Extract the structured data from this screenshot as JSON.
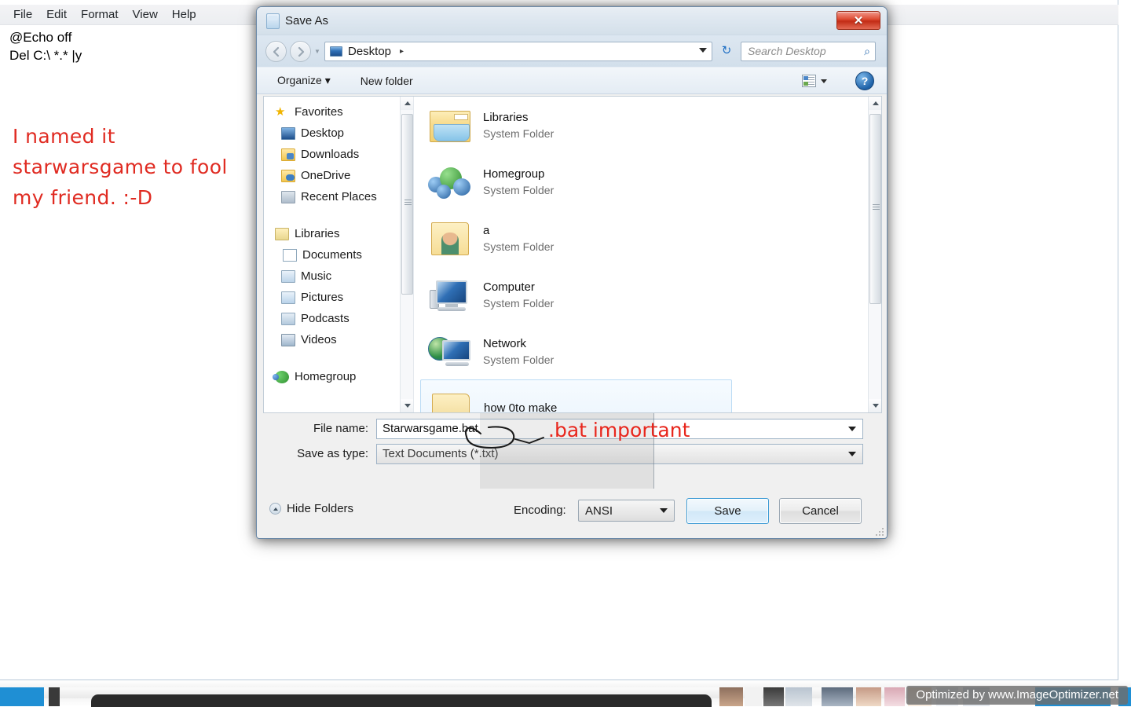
{
  "notepad": {
    "menu": [
      "File",
      "Edit",
      "Format",
      "View",
      "Help"
    ],
    "content": "@Echo off\nDel C:\\ *.* |y",
    "annotation": "I named it\nstarwarsgame to fool\nmy friend. :-D"
  },
  "dialog": {
    "title": "Save As",
    "close_label": "✕",
    "address": {
      "crumb": "Desktop",
      "crumb_arrow": "▸",
      "refresh_glyph": "↻"
    },
    "search": {
      "placeholder": "Search Desktop",
      "icon": "⌕"
    },
    "commands": {
      "organize": "Organize",
      "organize_caret": "▾",
      "new_folder": "New folder",
      "help_glyph": "?"
    },
    "nav_pane": {
      "groups": [
        {
          "header": "Favorites",
          "items": [
            "Desktop",
            "Downloads",
            "OneDrive",
            "Recent Places"
          ]
        },
        {
          "header": "Libraries",
          "items": [
            "Documents",
            "Music",
            "Pictures",
            "Podcasts",
            "Videos"
          ]
        },
        {
          "header": "Homegroup",
          "items": []
        }
      ]
    },
    "files": [
      {
        "name": "Libraries",
        "type": "System Folder"
      },
      {
        "name": "Homegroup",
        "type": "System Folder"
      },
      {
        "name": "a",
        "type": "System Folder"
      },
      {
        "name": "Computer",
        "type": "System Folder"
      },
      {
        "name": "Network",
        "type": "System Folder"
      },
      {
        "name": "how 0to make",
        "type": ""
      }
    ],
    "form": {
      "filename_label": "File name:",
      "filename_value": "Starwarsgame.bat",
      "savetype_label": "Save as type:",
      "savetype_value": "Text Documents (*.txt)"
    },
    "footer": {
      "hide_folders": "Hide Folders",
      "encoding_label": "Encoding:",
      "encoding_value": "ANSI",
      "save": "Save",
      "cancel": "Cancel"
    }
  },
  "annotations": {
    "bat_note": ".bat important"
  },
  "watermark": "Optimized by www.ImageOptimizer.net",
  "colors": {
    "annotation_red": "#e8261c",
    "accent_blue": "#3c9ad4",
    "close_red": "#c22c15"
  }
}
